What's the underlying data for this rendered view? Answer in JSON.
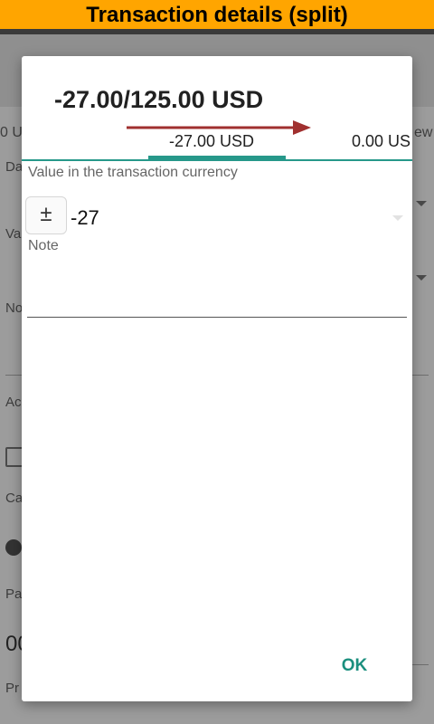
{
  "banner": {
    "title": "Transaction details (split)"
  },
  "background": {
    "tab_left": "0 U",
    "tab_right": "ew",
    "labels": [
      "Da",
      "Va",
      "No",
      "Ac",
      "Ca",
      "Pa",
      "Pr"
    ],
    "amount_partial": "00"
  },
  "dialog": {
    "title": "-27.00/125.00 USD",
    "tabs": [
      {
        "label": "-27.00 USD",
        "selected": true
      },
      {
        "label": "0.00 US",
        "selected": false
      }
    ],
    "value_label": "Value in the transaction currency",
    "sign_button": "±",
    "value": "-27",
    "note_label": "Note",
    "note_value": "",
    "ok_label": "OK"
  },
  "colors": {
    "banner": "#ffa500",
    "accent": "#26988a",
    "ok": "#1b8f7e",
    "arrow": "#a0302f"
  },
  "icons": [
    "swipe-right-arrow-icon",
    "plus-minus-icon",
    "dropdown-triangle-icon",
    "card-icon",
    "remove-icon"
  ]
}
